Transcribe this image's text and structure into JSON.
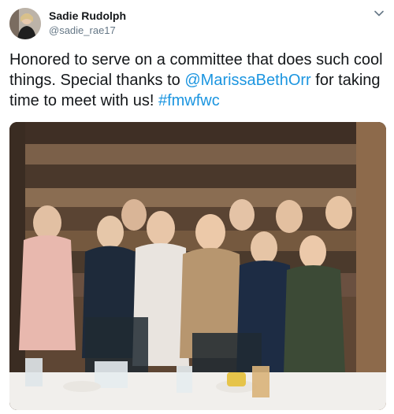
{
  "user": {
    "display_name": "Sadie Rudolph",
    "handle": "@sadie_rae17",
    "avatar_icon": "avatar-photo"
  },
  "menu_icon": "chevron-down-icon",
  "tweet": {
    "text_before": "Honored to serve on a committee that does such cool things. Special thanks to ",
    "mention": "@MarissaBethOrr",
    "text_middle": " for taking time to meet with us! ",
    "hashtag": "#fmwfwc"
  },
  "colors": {
    "link": "#1b95e0",
    "text": "#14171a",
    "muted": "#657786"
  },
  "media": {
    "icon": "photo-image"
  }
}
